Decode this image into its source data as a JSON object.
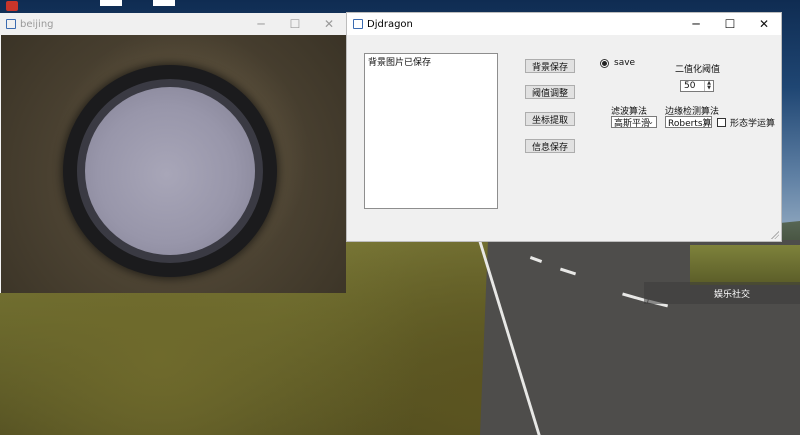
{
  "desktop": {
    "overlay_label": "娱乐社交"
  },
  "beijing_window": {
    "title": "beijing",
    "controls": {
      "minimize": "─",
      "maximize": "☐",
      "close": "✕"
    }
  },
  "dj_window": {
    "title": "Djdragon",
    "controls": {
      "minimize": "─",
      "maximize": "☐",
      "close": "✕"
    },
    "log_text": "背景图片已保存",
    "buttons": {
      "save_background": "背景保存",
      "adjust_threshold": "阈值调整",
      "extract_coords": "坐标提取",
      "save_info": "信息保存"
    },
    "save_radio_label": "save",
    "binary_threshold_label": "二值化阈值",
    "binary_threshold_value": "50",
    "filter_label": "滤波算法",
    "filter_value": "高斯平滑",
    "edge_label": "边缘检测算法",
    "edge_value": "Roberts算",
    "morph_label": "形态学运算"
  },
  "colors": {
    "dj_background": "#f0f0f0",
    "button_face": "#e1e1e1",
    "title_inactive": "#9a9a9a"
  }
}
